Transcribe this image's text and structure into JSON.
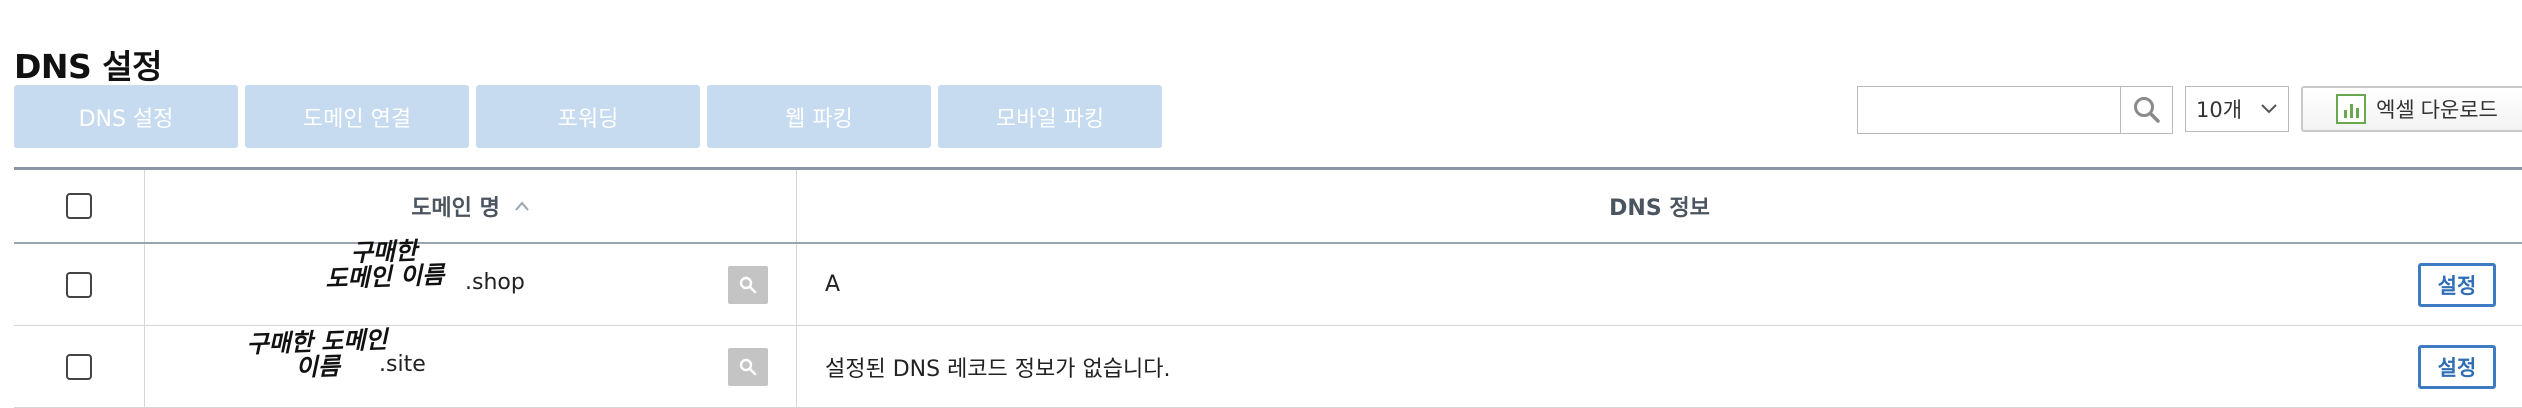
{
  "page": {
    "title": "DNS 설정"
  },
  "tabs": [
    {
      "label": "DNS 설정"
    },
    {
      "label": "도메인 연결"
    },
    {
      "label": "포워딩"
    },
    {
      "label": "웹 파킹"
    },
    {
      "label": "모바일 파킹"
    }
  ],
  "toolbar": {
    "search_value": "",
    "search_placeholder": "",
    "page_size": "10개",
    "excel_label": "엑셀 다운로드"
  },
  "table": {
    "headers": {
      "domain": "도메인 명",
      "dns": "DNS 정보"
    },
    "rows": [
      {
        "domain_handwritten": "구매한\n도메인 이름",
        "tld": ".shop",
        "dns_info": "A",
        "action": "설정"
      },
      {
        "domain_handwritten": "구매한 도메인\n이름",
        "tld": ".site",
        "dns_info": "설정된 DNS 레코드 정보가 없습니다.",
        "action": "설정"
      }
    ]
  },
  "colors": {
    "tab_bg": "#c6dbef",
    "accent_blue": "#3d7bc2",
    "table_top_border": "#8896a5",
    "excel_green": "#6aa84f"
  },
  "icons": {
    "search": "search-icon",
    "dropdown": "chevron-down-icon",
    "excel": "excel-chart-icon",
    "sort": "chevron-up-icon"
  }
}
